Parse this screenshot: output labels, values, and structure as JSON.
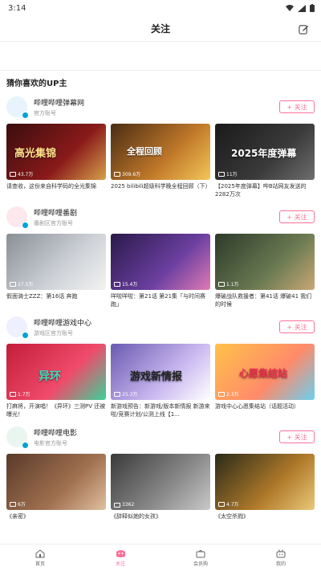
{
  "status": {
    "time": "3:14"
  },
  "header": {
    "title": "关注"
  },
  "section_title": "猜你喜欢的UP主",
  "follow_label": "+ 关注",
  "ups": [
    {
      "name": "哔哩哔哩弹幕网",
      "desc": "官方账号",
      "avatar_color": "#e8f4fb",
      "videos": [
        {
          "views": "43.7万",
          "title": "请查收，这份来自科学码的全光集锦",
          "overlay": "高光集锦"
        },
        {
          "views": "309.6万",
          "title": "2025 bilibili超级科学晚全程回顾（下）",
          "overlay": "全程回顾"
        },
        {
          "views": "11万",
          "title": "【2025年度弹幕】哔B站网友发送的2282万次",
          "overlay": "2025年度弹幕"
        }
      ]
    },
    {
      "name": "哔哩哔哩番剧",
      "desc": "番剧区官方账号",
      "avatar_color": "#fde8ee",
      "videos": [
        {
          "views": "27.5万",
          "title": "假面骑士ZZZ：第16话 奔跑",
          "overlay": ""
        },
        {
          "views": "15.4万",
          "title": "咩啦咩啦：第21话 第21集「与时间赛跑」",
          "overlay": ""
        },
        {
          "views": "1.1万",
          "title": "爆破战队救援者：第41话 爆破41 我们的时候",
          "overlay": ""
        }
      ]
    },
    {
      "name": "哔哩哔哩游戏中心",
      "desc": "游戏区官方账号",
      "avatar_color": "#eef0ff",
      "videos": [
        {
          "views": "1.7万",
          "title": "打麻将，开演唱！《异环》三测PV 还被曝光！",
          "overlay": "异环"
        },
        {
          "views": "25.3万",
          "title": "新游戏预告：新游戏/版本新情报 新游来啦/竞赛计划/公测上线【1...",
          "overlay": "游戏新情报"
        },
        {
          "views": "2.3万",
          "title": "游戏中心心愿集结站（话题活动）",
          "overlay": "心愿集结站"
        }
      ]
    },
    {
      "name": "哔哩哔哩电影",
      "desc": "电影官方账号",
      "avatar_color": "#e9f6ef",
      "videos": [
        {
          "views": "6万",
          "title": "《亲密》",
          "overlay": ""
        },
        {
          "views": "3362",
          "title": "《辞释似她的女孩》",
          "overlay": ""
        },
        {
          "views": "4.7万",
          "title": "《太空杀戮》",
          "overlay": ""
        }
      ]
    }
  ],
  "tabs": [
    {
      "label": "首页"
    },
    {
      "label": "关注"
    },
    {
      "label": "会员购"
    },
    {
      "label": "我的"
    }
  ],
  "colors": {
    "accent": "#fb7299",
    "verified": "#00a1d6"
  }
}
